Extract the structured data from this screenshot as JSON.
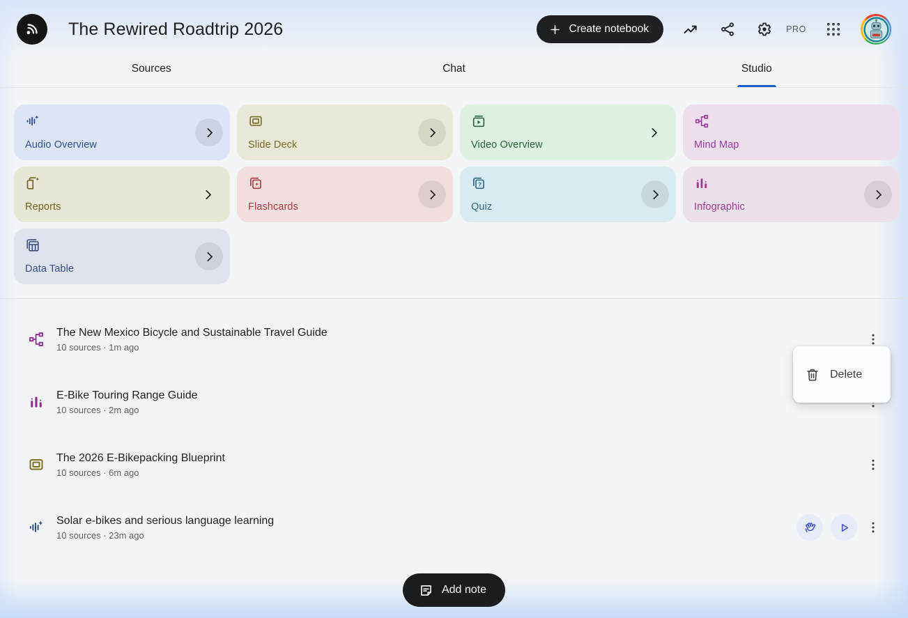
{
  "header": {
    "title": "The Rewired Roadtrip 2026",
    "create_notebook_label": "Create notebook",
    "pro_label": "PRO"
  },
  "tabs": [
    {
      "label": "Sources",
      "active": false
    },
    {
      "label": "Chat",
      "active": false
    },
    {
      "label": "Studio",
      "active": true
    }
  ],
  "studio": {
    "cards": [
      {
        "label": "Audio Overview",
        "icon": "audio-waveform-sparkle-icon",
        "bg": "#dde4f6",
        "fg": "#33508f",
        "chevron": "circle"
      },
      {
        "label": "Slide Deck",
        "icon": "slide-deck-icon",
        "bg": "#e9e8d8",
        "fg": "#776c27",
        "chevron": "circle"
      },
      {
        "label": "Video Overview",
        "icon": "video-overview-icon",
        "bg": "#def0e2",
        "fg": "#2a633c",
        "chevron": "plain"
      },
      {
        "label": "Mind Map",
        "icon": "mind-map-icon",
        "bg": "#ecdfeb",
        "fg": "#9c3d9f",
        "chevron": "none"
      },
      {
        "label": "Reports",
        "icon": "reports-sparkle-icon",
        "bg": "#e8e7d7",
        "fg": "#6e6423",
        "chevron": "plain"
      },
      {
        "label": "Flashcards",
        "icon": "flashcards-icon",
        "bg": "#f1dfdf",
        "fg": "#b23b42",
        "chevron": "circle"
      },
      {
        "label": "Quiz",
        "icon": "quiz-icon",
        "bg": "#d9eaf1",
        "fg": "#2e6a83",
        "chevron": "circle"
      },
      {
        "label": "Infographic",
        "icon": "infographic-icon",
        "bg": "#ebdfe9",
        "fg": "#a03a8c",
        "chevron": "circle"
      },
      {
        "label": "Data Table",
        "icon": "data-table-icon",
        "bg": "#dfe3ee",
        "fg": "#3b4f86",
        "chevron": "circle"
      }
    ]
  },
  "items": [
    {
      "icon": "mind-map-icon",
      "title": "The New Mexico Bicycle and Sustainable Travel Guide",
      "meta": "10 sources · 1m ago"
    },
    {
      "icon": "infographic-icon",
      "title": "E-Bike Touring Range Guide",
      "meta": "10 sources · 2m ago"
    },
    {
      "icon": "slide-deck-icon",
      "title": "The 2026 E-Bikepacking Blueprint",
      "meta": "10 sources · 6m ago"
    },
    {
      "icon": "audio-waveform-sparkle-icon",
      "title": "Solar e-bikes and serious language learning",
      "meta": "10 sources · 23m ago",
      "actions": [
        "interactive-mode",
        "play"
      ]
    }
  ],
  "context_menu": {
    "items": [
      {
        "label": "Delete",
        "icon": "trash-icon"
      }
    ]
  },
  "add_note": {
    "label": "Add note"
  },
  "colors": {
    "tab_active_underline": "#1b5cc8",
    "create_button_bg": "#1f2023",
    "add_note_bg": "#1b1c1e",
    "page_bg": "#f2f4f5",
    "edge_glow": "#c7dbf6",
    "audio_action_icon": "#4355cf",
    "audio_action_bg": "#e7eaf7"
  }
}
